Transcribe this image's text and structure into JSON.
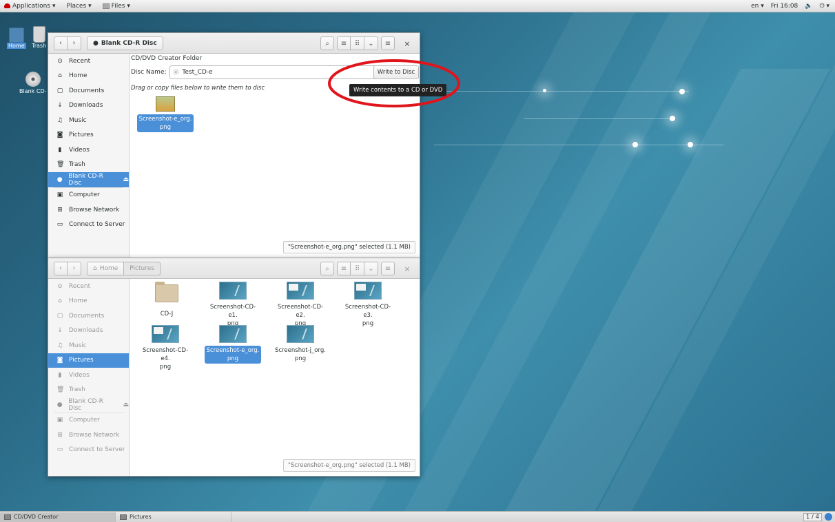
{
  "topbar": {
    "applications": "Applications",
    "places": "Places",
    "files": "Files",
    "lang": "en",
    "clock": "Fri 16:08",
    "volume_icon": "volume-icon",
    "power_icon": "power-icon"
  },
  "desktop": {
    "icons": [
      {
        "label": "Home"
      },
      {
        "label": "Trash"
      },
      {
        "label": "Blank CD-"
      }
    ]
  },
  "sidebar_items": [
    {
      "label": "Recent",
      "icon": "⊙"
    },
    {
      "label": "Home",
      "icon": "⌂"
    },
    {
      "label": "Documents",
      "icon": "▢"
    },
    {
      "label": "Downloads",
      "icon": "↓"
    },
    {
      "label": "Music",
      "icon": "♫"
    },
    {
      "label": "Pictures",
      "icon": "◙"
    },
    {
      "label": "Videos",
      "icon": "▮"
    },
    {
      "label": "Trash",
      "icon": "🗑"
    },
    {
      "label": "Blank CD-R Disc",
      "icon": "●",
      "eject": "⏏"
    },
    {
      "label": "Computer",
      "icon": "▣"
    },
    {
      "label": "Browse Network",
      "icon": "⊞"
    },
    {
      "label": "Connect to Server",
      "icon": "▭"
    }
  ],
  "cd_window": {
    "path_label": "Blank CD-R Disc",
    "folder_title": "CD/DVD Creator Folder",
    "disc_name_label": "Disc Name:",
    "disc_name_value": "Test_CD-e",
    "write_button": "Write to Disc",
    "tooltip": "Write contents to a CD or DVD",
    "instruction": "Drag or copy files below to write them to disc",
    "files": [
      {
        "name": "Screenshot-e_org.\npng"
      }
    ],
    "status": "\"Screenshot-e_org.png\" selected (1.1 MB)"
  },
  "pictures_window": {
    "path_home": "Home",
    "path_current": "Pictures",
    "files": [
      {
        "name": "CD-J"
      },
      {
        "name": "Screenshot-CD-e1.\npng"
      },
      {
        "name": "Screenshot-CD-e2.\npng"
      },
      {
        "name": "Screenshot-CD-e3.\npng"
      },
      {
        "name": "Screenshot-CD-e4.\npng"
      },
      {
        "name": "Screenshot-e_org.\npng"
      },
      {
        "name": "Screenshot-j_org.\npng"
      }
    ],
    "status": "\"Screenshot-e_org.png\" selected (1.1 MB)"
  },
  "taskbar": {
    "task1": "CD/DVD Creator",
    "task2": "Pictures",
    "workspace": "1 / 4"
  },
  "colors": {
    "accent": "#4a90d9",
    "annotation": "#e0151b"
  }
}
